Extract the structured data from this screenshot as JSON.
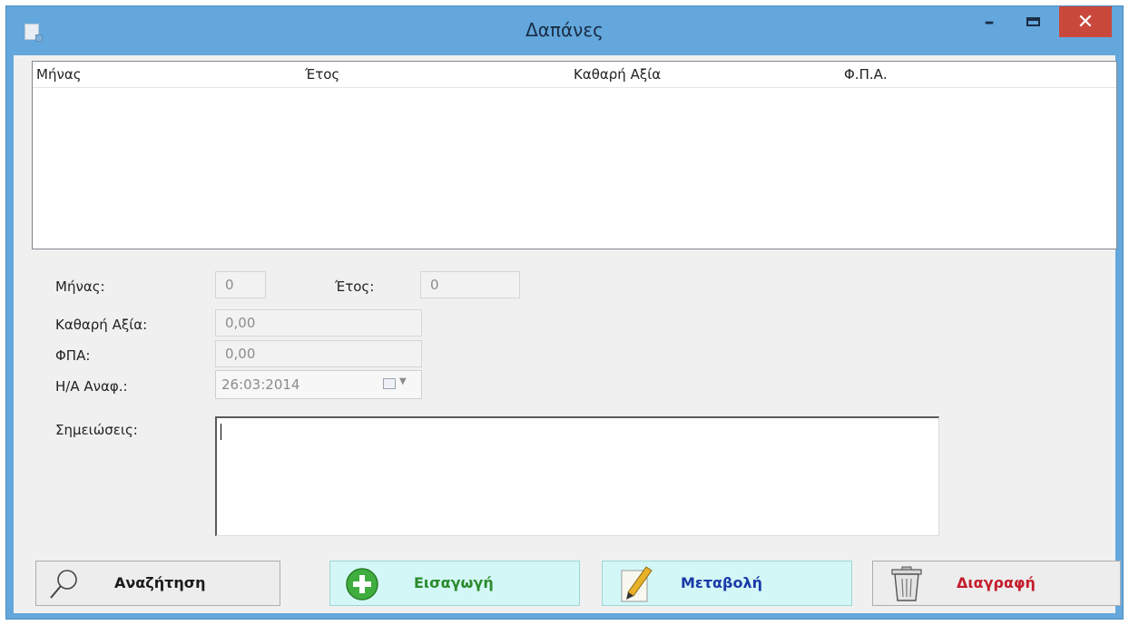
{
  "window": {
    "title": "Δαπάνες",
    "minimize_glyph": "–",
    "close_glyph": "✕"
  },
  "list": {
    "columns": [
      "Μήνας",
      "Έτος",
      "Καθαρή Αξία",
      "Φ.Π.Α."
    ]
  },
  "form": {
    "month_label": "Μήνας:",
    "month_value": "0",
    "year_label": "Έτος:",
    "year_value": "0",
    "net_label": "Καθαρή Αξία:",
    "net_value": "0,00",
    "vat_label": "ΦΠΑ:",
    "vat_value": "0,00",
    "date_label": "Η/Α Αναφ.:",
    "date_value": "26:03:2014",
    "notes_label": "Σημειώσεις:",
    "notes_value": ""
  },
  "buttons": {
    "search": "Αναζήτηση",
    "insert": "Εισαγωγή",
    "modify": "Μεταβολή",
    "delete": "Διαγραφή"
  },
  "icons": {
    "search": "magnifier-icon",
    "insert": "add-circle-icon",
    "modify": "pencil-edit-icon",
    "delete": "trash-bin-icon",
    "calendar": "calendar-icon"
  },
  "colors": {
    "titlebar": "#63a7dc",
    "close_button": "#c9483c",
    "accent_buttons": "#d3f7f6",
    "insert_label": "#2b8a2b",
    "modify_label": "#1a3aa8",
    "delete_label": "#c41c2c"
  }
}
